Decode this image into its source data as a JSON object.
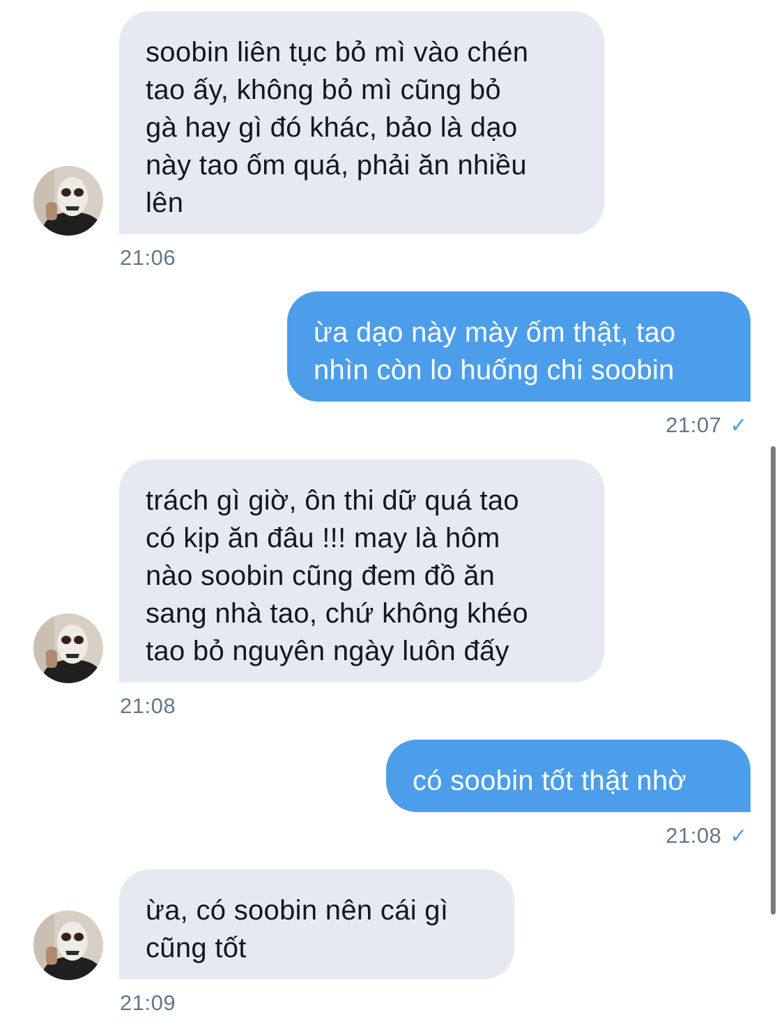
{
  "conversation": {
    "messages": [
      {
        "direction": "in",
        "text": "soobin liên tục bỏ mì vào chén\ntao ấy, không bỏ mì cũng bỏ\ngà hay gì đó khác, bảo là dạo\nnày tao ốm quá, phải ăn nhiều\nlên",
        "time": "21:06"
      },
      {
        "direction": "out",
        "text": "ừa dạo này mày ốm thật, tao\nnhìn còn lo huống chi soobin",
        "time": "21:07",
        "status": "✓"
      },
      {
        "direction": "in",
        "text": "trách gì giờ, ôn thi dữ quá tao\ncó kịp ăn đâu !!! may là hôm\nnào soobin cũng đem đồ ăn\nsang nhà tao, chứ không khéo\ntao bỏ nguyên ngày luôn đấy",
        "time": "21:08"
      },
      {
        "direction": "out",
        "text": "có soobin tốt thật nhờ",
        "time": "21:08",
        "status": "✓"
      },
      {
        "direction": "in",
        "text": "ừa, có soobin nên cái gì\ncũng tốt",
        "time": "21:09"
      }
    ]
  },
  "colors": {
    "incoming_bubble": "#e6e9f0",
    "outgoing_bubble": "#4c9eea",
    "timestamp": "#657786",
    "read_check": "#4c9eea"
  },
  "icons": {
    "avatar": "masked-person-avatar",
    "read_status": "checkmark-icon"
  }
}
